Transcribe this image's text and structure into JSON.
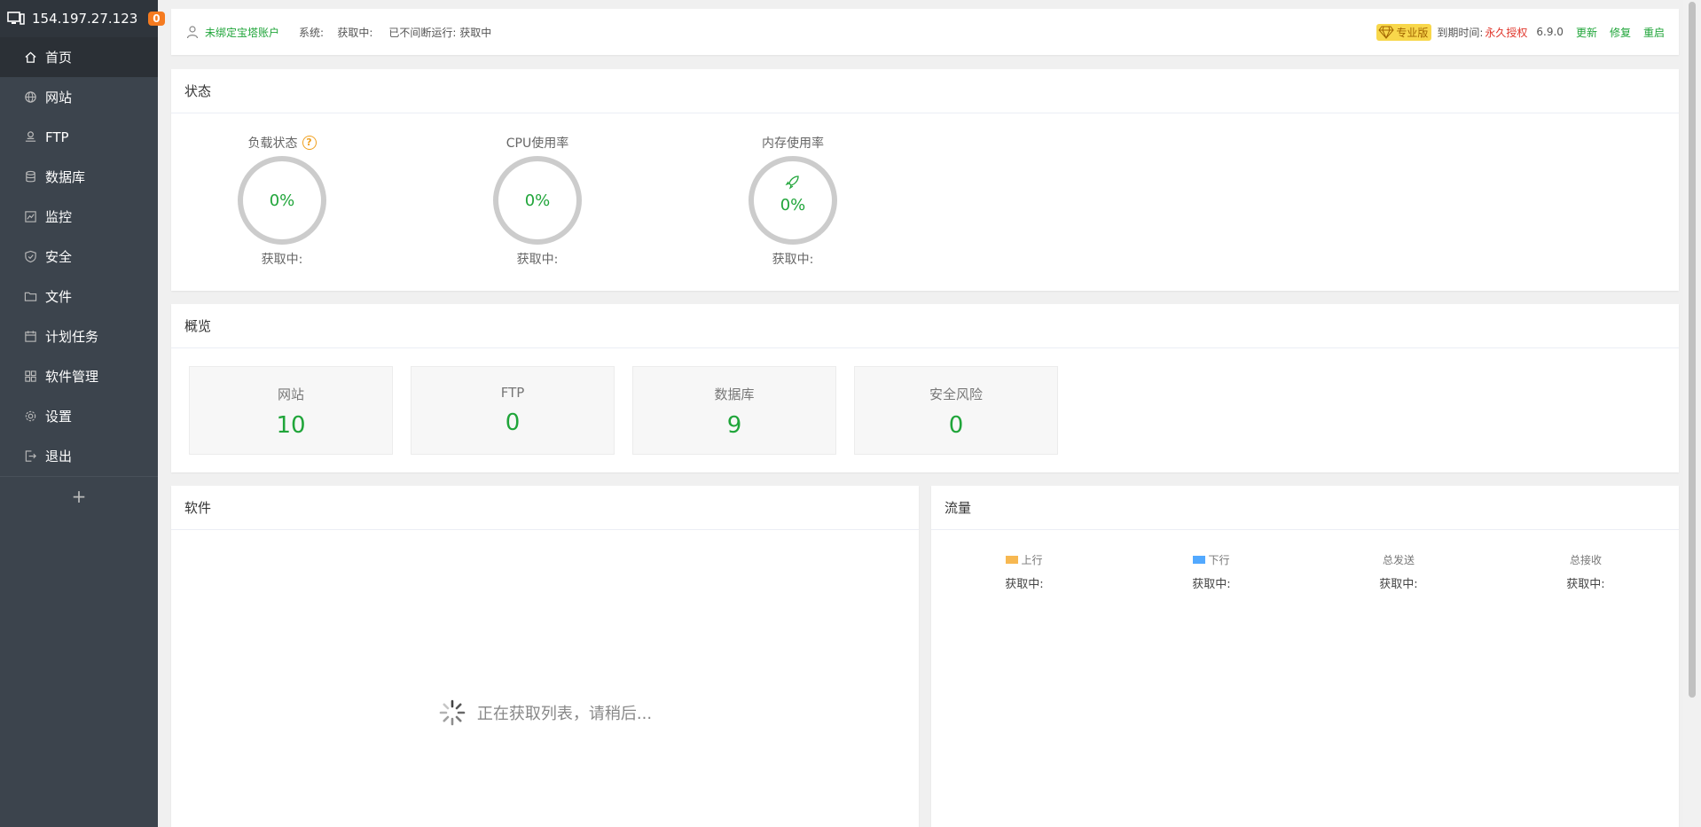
{
  "sidebar": {
    "ip": "154.197.27.123",
    "badge": "0",
    "items": [
      {
        "label": "首页",
        "icon": "home-icon"
      },
      {
        "label": "网站",
        "icon": "globe-icon"
      },
      {
        "label": "FTP",
        "icon": "ftp-icon"
      },
      {
        "label": "数据库",
        "icon": "database-icon"
      },
      {
        "label": "监控",
        "icon": "monitor-icon"
      },
      {
        "label": "安全",
        "icon": "shield-icon"
      },
      {
        "label": "文件",
        "icon": "folder-icon"
      },
      {
        "label": "计划任务",
        "icon": "calendar-icon"
      },
      {
        "label": "软件管理",
        "icon": "apps-icon"
      },
      {
        "label": "设置",
        "icon": "gear-icon"
      },
      {
        "label": "退出",
        "icon": "logout-icon"
      }
    ],
    "add": "+"
  },
  "topbar": {
    "bind_account": "未绑定宝塔账户",
    "system": "系统:",
    "system_value": "获取中:",
    "uptime": "已不间断运行: 获取中",
    "pro_label": "专业版",
    "expire_label": "到期时间:",
    "expire_value": "永久授权",
    "version": "6.9.0",
    "update": "更新",
    "repair": "修复",
    "restart": "重启"
  },
  "status": {
    "title": "状态",
    "gauges": [
      {
        "label": "负载状态",
        "value": "0%",
        "sub": "获取中:"
      },
      {
        "label": "CPU使用率",
        "value": "0%",
        "sub": "获取中:"
      },
      {
        "label": "内存使用率",
        "value": "0%",
        "sub": "获取中:"
      }
    ]
  },
  "overview": {
    "title": "概览",
    "cards": [
      {
        "label": "网站",
        "value": "10"
      },
      {
        "label": "FTP",
        "value": "0"
      },
      {
        "label": "数据库",
        "value": "9"
      },
      {
        "label": "安全风险",
        "value": "0"
      }
    ]
  },
  "software": {
    "title": "软件",
    "loading": "正在获取列表，请稍后..."
  },
  "traffic": {
    "title": "流量",
    "columns": [
      {
        "label": "上行",
        "value": "获取中:",
        "color": "#f7b851"
      },
      {
        "label": "下行",
        "value": "获取中:",
        "color": "#52a9ff"
      },
      {
        "label": "总发送",
        "value": "获取中:"
      },
      {
        "label": "总接收",
        "value": "获取中:"
      }
    ]
  },
  "colors": {
    "accent": "#20a53a",
    "sidebar": "#3c444d",
    "warning": "#e0372c"
  }
}
